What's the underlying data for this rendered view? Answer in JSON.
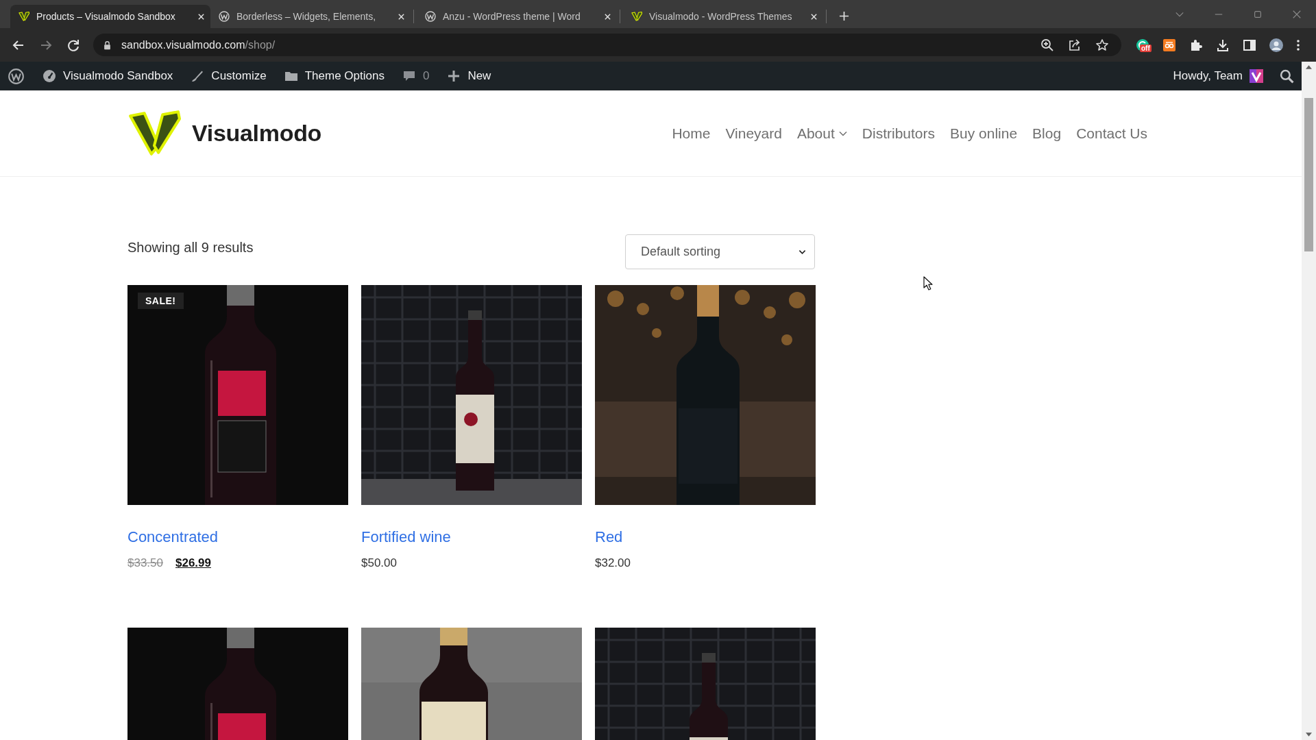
{
  "browser": {
    "tabs": [
      {
        "title": "Products – Visualmodo Sandbox",
        "kind": "visualmodo",
        "selected": true
      },
      {
        "title": "Borderless – Widgets, Elements,",
        "kind": "wordpress",
        "selected": false
      },
      {
        "title": "Anzu - WordPress theme | Word",
        "kind": "wordpress",
        "selected": false
      },
      {
        "title": "Visualmodo - WordPress Themes",
        "kind": "visualmodo",
        "selected": false
      }
    ],
    "address_bar": {
      "host": "sandbox.visualmodo.com",
      "path": "/shop/"
    },
    "extension_badge": "off"
  },
  "admin_bar": {
    "items": [
      {
        "kind": "wordpress"
      },
      {
        "kind": "dashboard",
        "label": "Visualmodo Sandbox"
      },
      {
        "kind": "brush",
        "label": "Customize"
      },
      {
        "kind": "folder",
        "label": "Theme Options"
      },
      {
        "kind": "comments",
        "label": "0"
      },
      {
        "kind": "new",
        "label": "New"
      }
    ],
    "greeting": "Howdy, Team"
  },
  "site_header": {
    "logo_text": "Visualmodo",
    "nav": [
      {
        "label": "Home",
        "has_submenu": false
      },
      {
        "label": "Vineyard",
        "has_submenu": false
      },
      {
        "label": "About",
        "has_submenu": true
      },
      {
        "label": "Distributors",
        "has_submenu": false
      },
      {
        "label": "Buy online",
        "has_submenu": false
      },
      {
        "label": "Blog",
        "has_submenu": false
      },
      {
        "label": "Contact Us",
        "has_submenu": false
      }
    ]
  },
  "shop": {
    "result_count": "Showing all 9 results",
    "sorting": "Default sorting",
    "products": [
      {
        "kind": "studio",
        "badge": "SALE!",
        "title": "Concentrated",
        "old_price": "$33.50",
        "price": "$26.99"
      },
      {
        "kind": "cellar",
        "title": "Fortified wine",
        "price": "$50.00"
      },
      {
        "kind": "bokeh",
        "title": "Red",
        "price": "$32.00"
      },
      {
        "kind": "studio"
      },
      {
        "kind": "backdrop"
      },
      {
        "kind": "cellar"
      }
    ]
  }
}
